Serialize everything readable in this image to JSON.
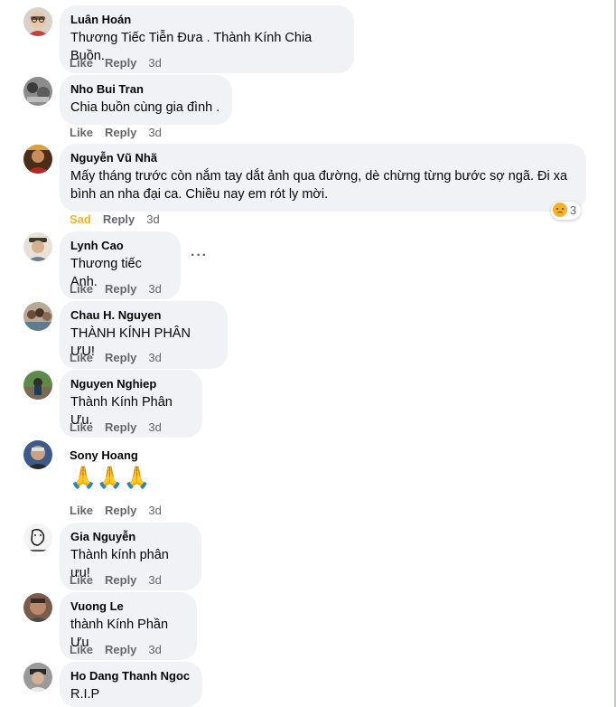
{
  "labels": {
    "like": "Like",
    "reply": "Reply",
    "sad": "Sad",
    "more": "···"
  },
  "colors": {
    "bubble": "#f0f2f5",
    "action": "#65676b",
    "sad": "#f7b125"
  },
  "comments": [
    {
      "author": "Luân Hoán",
      "text": "Thương Tiếc Tiễn Đưa . Thành Kính Chia Buồn.",
      "time": "3d"
    },
    {
      "author": "Nho Bui Tran",
      "text": "Chia buồn cùng gia đình .",
      "time": "3d"
    },
    {
      "author": "Nguyễn Vũ Nhã",
      "text_line1": "Mấy tháng trước còn nắm tay dắt ảnh qua đường, dè chừng từng bước sợ ngã. Đi xa",
      "text_line2": "bình an nha đại ca. Chiều nay em rót ly mời.",
      "time": "3d",
      "reaction_icon": "sad-emoji-icon",
      "reaction_count": "3"
    },
    {
      "author": "Lynh Cao",
      "text": "Thương tiếc Anh.",
      "time": "3d"
    },
    {
      "author": "Chau H. Nguyen",
      "text": "THÀNH KÍNH PHÂN ƯU!",
      "time": "3d"
    },
    {
      "author": "Nguyen Nghiep",
      "text": "Thành Kính Phân Ưu.",
      "time": "3d"
    },
    {
      "author": "Sony Hoang",
      "emoji": [
        "🙏",
        "🙏",
        "🙏"
      ],
      "emoji_icon": "folded-hands-icon",
      "time": "3d"
    },
    {
      "author": "Gia Nguyễn",
      "text": "Thành kính phân ưu!",
      "time": "3d"
    },
    {
      "author": "Vuong Le",
      "text": "thành Kính Phần Ưu",
      "time": "3d"
    },
    {
      "author": "Ho Dang Thanh Ngoc",
      "text": "R.I.P"
    }
  ]
}
